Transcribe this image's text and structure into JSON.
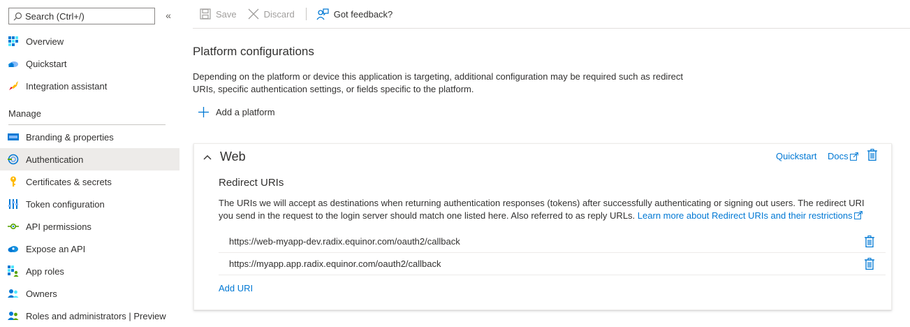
{
  "sidebar": {
    "search_placeholder": "Search (Ctrl+/)",
    "collapse_glyph": "«",
    "items_top": [
      {
        "label": "Overview",
        "icon": "overview-icon"
      },
      {
        "label": "Quickstart",
        "icon": "quickstart-icon"
      },
      {
        "label": "Integration assistant",
        "icon": "rocket-icon"
      }
    ],
    "section_label": "Manage",
    "items_manage": [
      {
        "label": "Branding & properties",
        "icon": "branding-icon"
      },
      {
        "label": "Authentication",
        "icon": "authentication-icon",
        "active": true
      },
      {
        "label": "Certificates & secrets",
        "icon": "key-icon"
      },
      {
        "label": "Token configuration",
        "icon": "token-icon"
      },
      {
        "label": "API permissions",
        "icon": "api-permissions-icon"
      },
      {
        "label": "Expose an API",
        "icon": "cloud-icon"
      },
      {
        "label": "App roles",
        "icon": "app-roles-icon"
      },
      {
        "label": "Owners",
        "icon": "owners-icon"
      },
      {
        "label": "Roles and administrators | Preview",
        "icon": "roles-icon"
      }
    ]
  },
  "toolbar": {
    "save_label": "Save",
    "discard_label": "Discard",
    "feedback_label": "Got feedback?"
  },
  "main": {
    "title": "Platform configurations",
    "description": "Depending on the platform or device this application is targeting, additional configuration may be required such as redirect URIs, specific authentication settings, or fields specific to the platform.",
    "add_platform_label": "Add a platform"
  },
  "web_card": {
    "title": "Web",
    "quickstart_label": "Quickstart",
    "docs_label": "Docs",
    "redirect_title": "Redirect URIs",
    "redirect_desc": "The URIs we will accept as destinations when returning authentication responses (tokens) after successfully authenticating or signing out users. The redirect URI you send in the request to the login server should match one listed here. Also referred to as reply URLs.",
    "learn_more_label": "Learn more about Redirect URIs and their restrictions",
    "uris": [
      "https://web-myapp-dev.radix.equinor.com/oauth2/callback",
      "https://myapp.app.radix.equinor.com/oauth2/callback"
    ],
    "add_uri_label": "Add URI"
  },
  "colors": {
    "accent": "#0078d4",
    "active_bg": "#edebe9",
    "text": "#323130",
    "disabled": "#a19f9d"
  }
}
